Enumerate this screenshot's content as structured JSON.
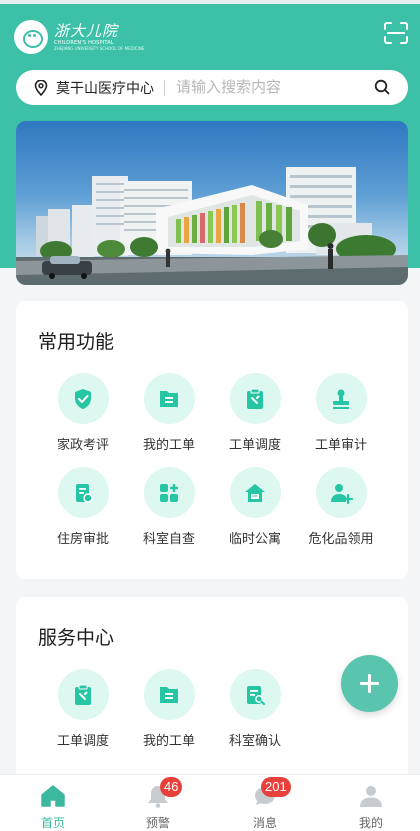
{
  "header": {
    "logo_cn": "浙大儿院",
    "logo_en": "CHILDREN'S HOSPITAL",
    "logo_en_sub": "ZHEJIANG UNIVERSITY SCHOOL OF MEDICINE",
    "scan_icon": "scan-icon"
  },
  "search": {
    "location": "莫干山医疗中心",
    "placeholder": "请输入搜索内容"
  },
  "colors": {
    "brand": "#3cc1a8",
    "icon_bg": "#ddf7f1",
    "icon_fg": "#26c6a4",
    "badge": "#e8413b"
  },
  "common": {
    "title": "常用功能",
    "items": [
      {
        "label": "家政考评",
        "icon": "shield-check-icon"
      },
      {
        "label": "我的工单",
        "icon": "folder-icon"
      },
      {
        "label": "工单调度",
        "icon": "clipboard-wrench-icon"
      },
      {
        "label": "工单审计",
        "icon": "stamp-icon"
      },
      {
        "label": "住房审批",
        "icon": "document-seal-icon"
      },
      {
        "label": "科室自查",
        "icon": "grid-plus-icon"
      },
      {
        "label": "临时公寓",
        "icon": "house-card-icon"
      },
      {
        "label": "危化品领用",
        "icon": "user-add-icon"
      }
    ]
  },
  "service": {
    "title": "服务中心",
    "items": [
      {
        "label": "工单调度",
        "icon": "clipboard-wrench-icon"
      },
      {
        "label": "我的工单",
        "icon": "folder-icon"
      },
      {
        "label": "科室确认",
        "icon": "document-search-icon"
      }
    ]
  },
  "tabs": [
    {
      "label": "首页",
      "icon": "home-icon",
      "active": true
    },
    {
      "label": "预警",
      "icon": "bell-icon",
      "badge": "46"
    },
    {
      "label": "消息",
      "icon": "chat-icon",
      "badge": "201"
    },
    {
      "label": "我的",
      "icon": "user-icon"
    }
  ]
}
